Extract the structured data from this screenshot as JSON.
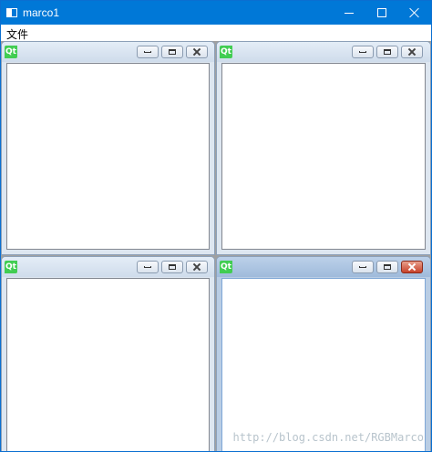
{
  "window": {
    "title": "marco1"
  },
  "menu": {
    "items": [
      "文件"
    ]
  },
  "subwindows": [
    {
      "icon_text": "Qt",
      "active": false
    },
    {
      "icon_text": "Qt",
      "active": false
    },
    {
      "icon_text": "Qt",
      "active": false
    },
    {
      "icon_text": "Qt",
      "active": true
    }
  ],
  "watermark": "http://blog.csdn.net/RGBMarco",
  "colors": {
    "titlebar": "#0078d7",
    "qt_green": "#41cd52",
    "active_close": "#c7412a"
  },
  "icons": {
    "app": "window-icon",
    "minimize": "minimize-icon",
    "maximize": "maximize-icon",
    "close": "close-icon",
    "restore": "restore-icon",
    "qt": "qt-logo-icon"
  }
}
